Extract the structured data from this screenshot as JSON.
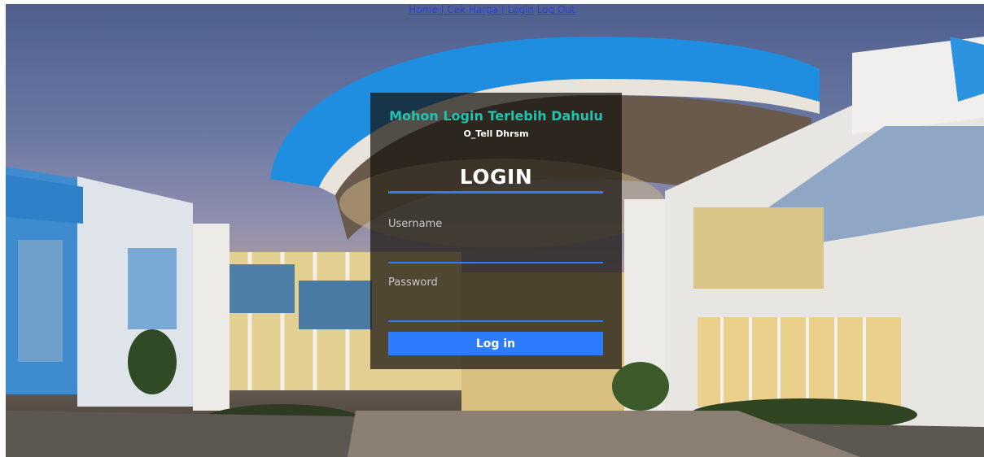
{
  "nav": {
    "home": "Home",
    "sep1": " | ",
    "cek_harga": "Cek Harga",
    "sep2": " | ",
    "login": "Login",
    "logout": "Log Out"
  },
  "panel": {
    "title": "Mohon Login Terlebih Dahulu",
    "subtitle": "O_Tell Dhrsm",
    "heading": "LOGIN",
    "username_label": "Username",
    "password_label": "Password",
    "login_button": "Log in"
  },
  "colors": {
    "accent": "#2d7bff",
    "title": "#1fc3b0",
    "link": "#2e3fd6"
  }
}
